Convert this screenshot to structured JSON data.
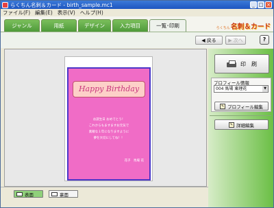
{
  "window": {
    "title": "らくちん名刺＆カード - birth_sample.mc1",
    "controls": [
      "_",
      "□",
      "×"
    ]
  },
  "menubar": [
    {
      "label": "ファイル(F)"
    },
    {
      "label": "編集(E)"
    },
    {
      "label": "表示(V)"
    },
    {
      "label": "ヘルプ(H)"
    }
  ],
  "tabs": [
    {
      "label": "ジャンル"
    },
    {
      "label": "用紙"
    },
    {
      "label": "デザイン"
    },
    {
      "label": "入力項目"
    },
    {
      "label": "一覧･印刷",
      "active": true
    }
  ],
  "brand": {
    "small": "らくちん",
    "text": "名刺＆カード"
  },
  "toolbar": {
    "back_label": "戻る",
    "next_label": "次へ",
    "help_label": "?"
  },
  "card": {
    "banner": "Happy Birthday",
    "message_lines": [
      "お誕生日 おめでとう！",
      "これからもますますお元気で",
      "素敵な１年になりますように",
      "夢を大切にしてね！！"
    ],
    "signature": "花子　馬場 花"
  },
  "sidebar": {
    "print_label": "印　刷",
    "profile_info_label": "プロフィール情報",
    "profile_selected": "004 馬場 東理花",
    "profile_edit_label": "プロフィール編集",
    "detail_edit_label": "詳細編集"
  },
  "bottombar": {
    "front_label": "表面",
    "back_label": "裏面"
  },
  "colors": {
    "tab_green": "#4e9a3a",
    "card_pink": "#f06cc6",
    "card_border": "#4a35c8",
    "banner_text": "#c8347c"
  }
}
